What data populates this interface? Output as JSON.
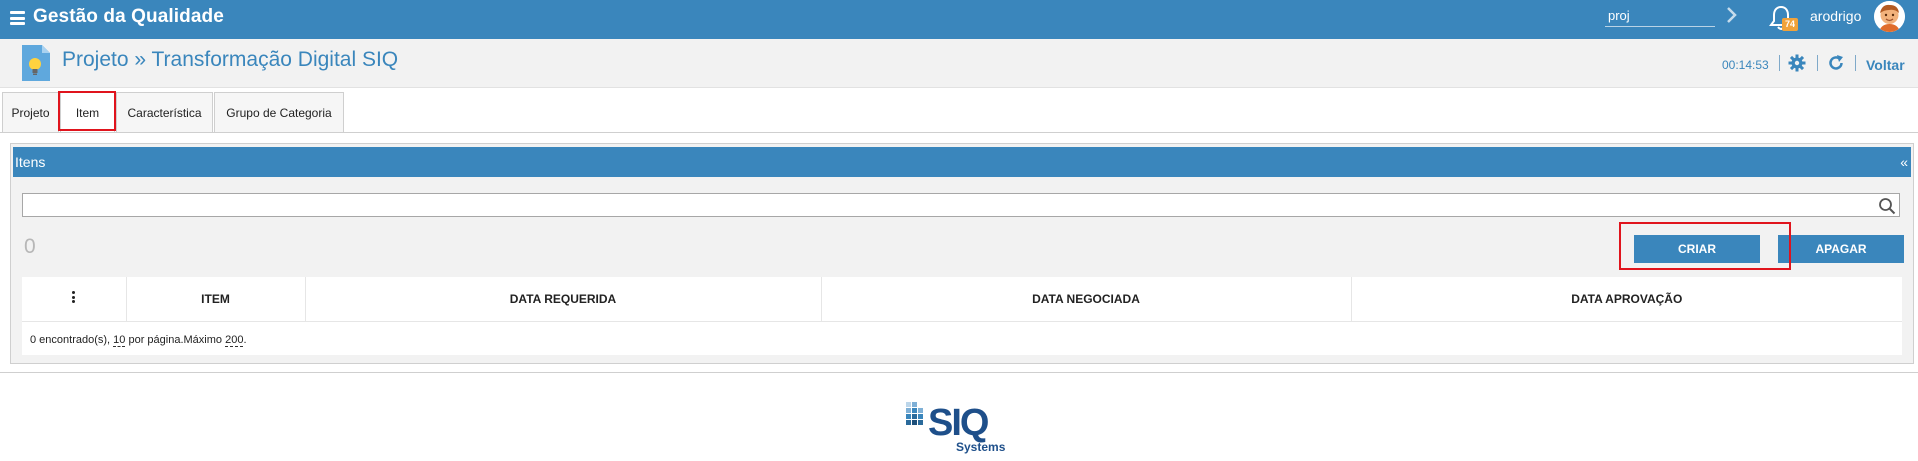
{
  "topbar": {
    "app_title": "Gestão da Qualidade",
    "search_value": "proj",
    "notification_count": "74",
    "username": "arodrigo",
    "menu_icon": "hamburger-icon",
    "go_icon": "chevron-right-icon",
    "bell_icon": "bell-icon"
  },
  "header": {
    "title": "Projeto » Transformação Digital SIQ",
    "clock": "00:14:53",
    "back_label": "Voltar",
    "separator": "|"
  },
  "tabs": [
    {
      "label": "Projeto",
      "active": false
    },
    {
      "label": "Item",
      "active": true
    },
    {
      "label": "Característica",
      "active": false
    },
    {
      "label": "Grupo de Categoria",
      "active": false
    }
  ],
  "panel": {
    "title": "Itens",
    "collapse": "«",
    "search_value": "",
    "count": "0",
    "create_label": "CRIAR",
    "delete_label": "APAGAR",
    "table": {
      "columns": [
        "ITEM",
        "DATA REQUERIDA",
        "DATA NEGOCIADA",
        "DATA APROVAÇÃO"
      ],
      "rows": []
    },
    "footer": {
      "found": "0 encontrado(s), ",
      "per_page_value": "10",
      "per_page_text": " por página.Máximo ",
      "max_value": "200",
      "end": "."
    }
  },
  "colors": {
    "primary": "#3a86bc",
    "highlight": "#e0141d",
    "badge": "#f0a23a"
  },
  "logo": {
    "brand": "SIQ",
    "sub": "Systems"
  }
}
